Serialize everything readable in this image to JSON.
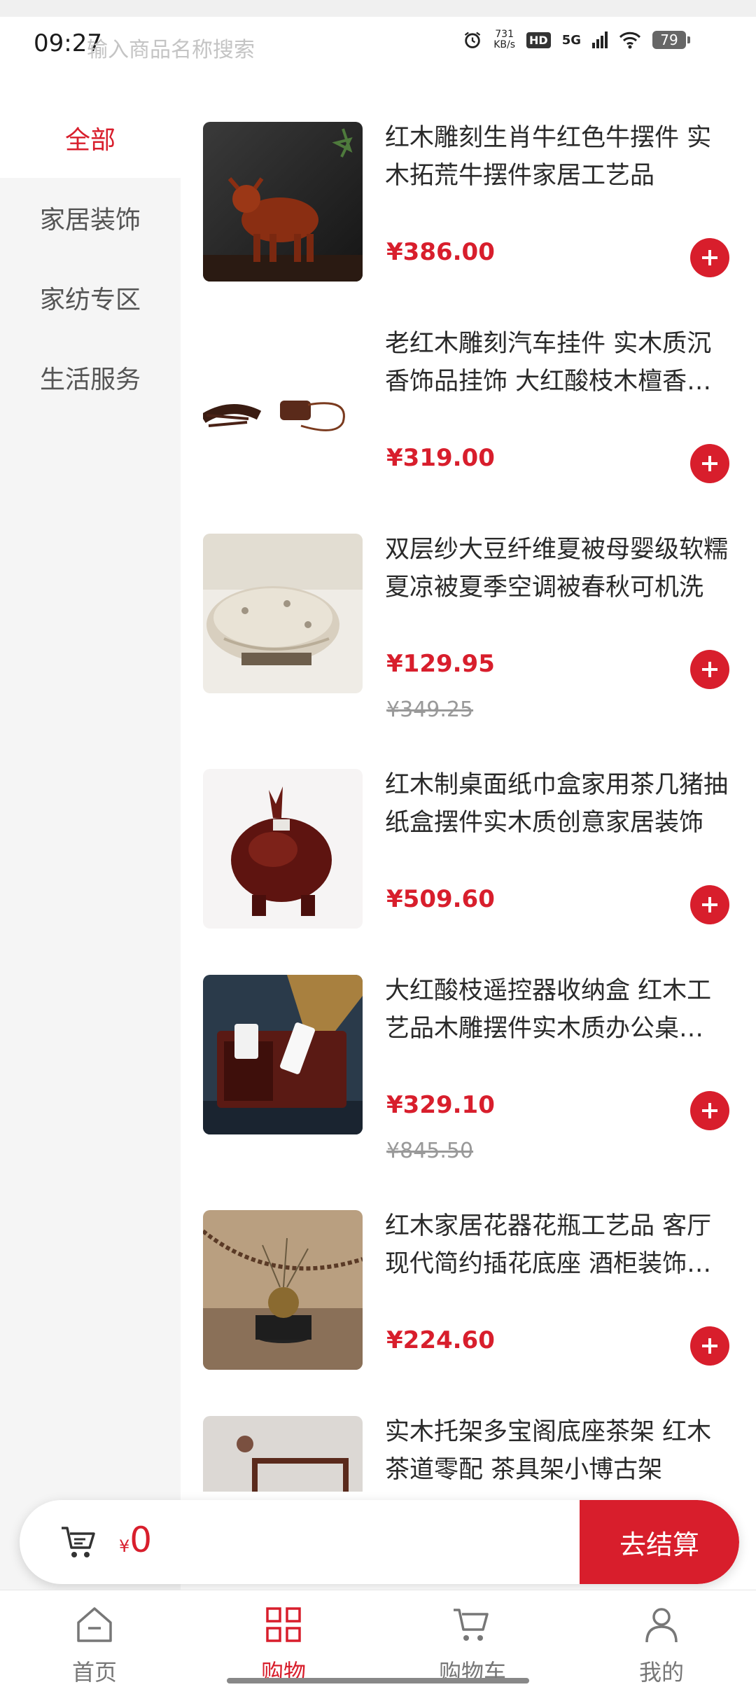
{
  "status_bar": {
    "time": "09:27",
    "net_speed_value": "731",
    "net_speed_unit": "KB/s",
    "hd_label": "HD",
    "network": "5G",
    "battery": "79"
  },
  "search": {
    "placeholder": "输入商品名称搜索"
  },
  "categories": [
    {
      "label": "全部",
      "active": true
    },
    {
      "label": "家居装饰",
      "active": false
    },
    {
      "label": "家纺专区",
      "active": false
    },
    {
      "label": "生活服务",
      "active": false
    }
  ],
  "products": [
    {
      "title": "红木雕刻生肖牛红色牛摆件 实木拓荒牛摆件家居工艺品",
      "price": "¥386.00",
      "original_price": ""
    },
    {
      "title": "老红木雕刻汽车挂件 实木质沉香饰品挂饰 大红酸枝木檀香汽车挂件",
      "price": "¥319.00",
      "original_price": ""
    },
    {
      "title": "双层纱大豆纤维夏被母婴级软糯夏凉被夏季空调被春秋可机洗",
      "price": "¥129.95",
      "original_price": "¥349.25"
    },
    {
      "title": "红木制桌面纸巾盒家用茶几猪抽纸盒摆件实木质创意家居装饰",
      "price": "¥509.60",
      "original_price": ""
    },
    {
      "title": "大红酸枝遥控器收纳盒 红木工艺品木雕摆件实木质办公桌面收纳",
      "price": "¥329.10",
      "original_price": "¥845.50"
    },
    {
      "title": "红木家居花器花瓶工艺品 客厅现代简约插花底座 酒柜装饰摆件",
      "price": "¥224.60",
      "original_price": ""
    },
    {
      "title": "实木托架多宝阁底座茶架 红木茶道零配 茶具架小博古架",
      "price": "",
      "original_price": ""
    }
  ],
  "cart": {
    "currency": "¥",
    "total": "0",
    "checkout_label": "去结算"
  },
  "tabbar": [
    {
      "label": "首页",
      "icon": "home-icon",
      "active": false
    },
    {
      "label": "购物",
      "icon": "grid-icon",
      "active": true
    },
    {
      "label": "购物车",
      "icon": "cart-icon",
      "active": false
    },
    {
      "label": "我的",
      "icon": "user-icon",
      "active": false
    }
  ],
  "colors": {
    "accent": "#d81e2c",
    "sidebar_bg": "#f5f5f5",
    "text": "#2a2a2a",
    "muted": "#999999"
  }
}
